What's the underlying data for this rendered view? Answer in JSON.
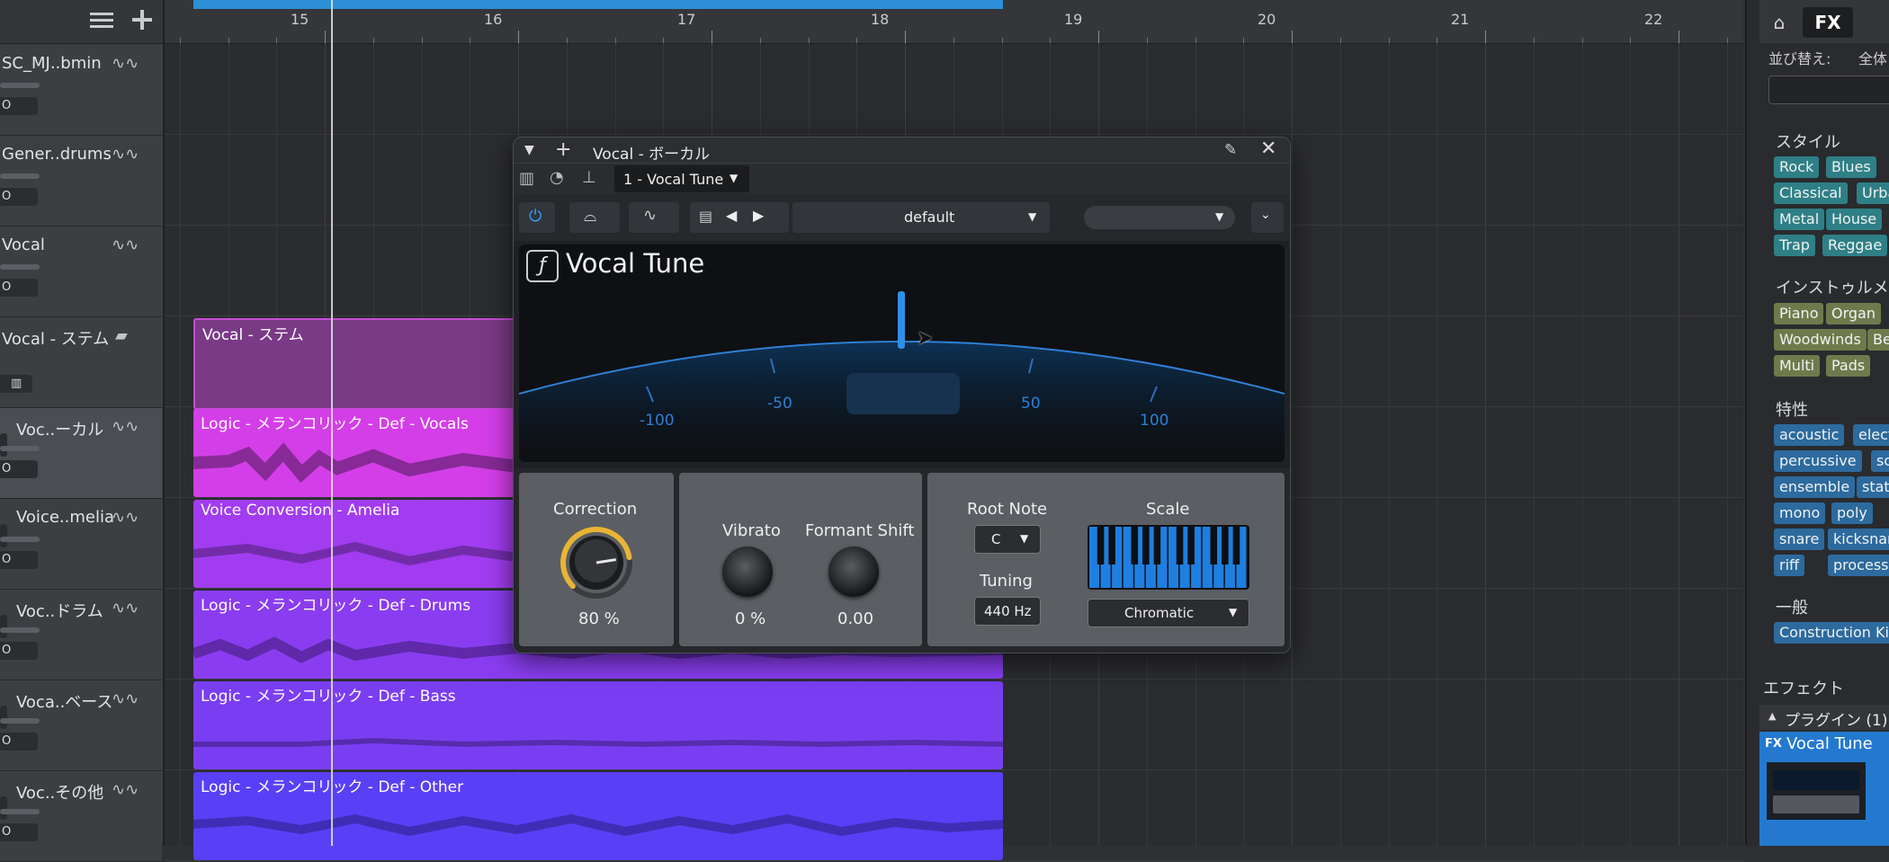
{
  "timeline": {
    "bars": [
      "15",
      "16",
      "17",
      "18",
      "19",
      "20",
      "21",
      "22"
    ]
  },
  "tracks": [
    {
      "name": "SC_MJ..bmin",
      "mon": "O"
    },
    {
      "name": "Gener..drums",
      "mon": "O"
    },
    {
      "name": "Vocal",
      "mon": "O"
    },
    {
      "name": "Vocal - ステム",
      "mon": ""
    },
    {
      "name": "Voc..ーカル",
      "mon": "O"
    },
    {
      "name": "Voice..melia",
      "mon": "O"
    },
    {
      "name": "Voc..ドラム",
      "mon": "O"
    },
    {
      "name": "Voca..ベース",
      "mon": "O"
    },
    {
      "name": "Voc..その他",
      "mon": "O"
    }
  ],
  "clips": [
    {
      "label": "Vocal - ステム"
    },
    {
      "label": "Logic - メランコリック - Def - Vocals"
    },
    {
      "label": "Voice Conversion - Amelia"
    },
    {
      "label": "Logic - メランコリック - Def - Drums"
    },
    {
      "label": "Logic - メランコリック - Def - Bass"
    },
    {
      "label": "Logic - メランコリック - Def - Other"
    }
  ],
  "plugin": {
    "window_title": "Vocal - ボーカル",
    "insert": "1 - Vocal Tune",
    "preset": "default",
    "name": "Vocal Tune",
    "meter_labels": [
      "-100",
      "-50",
      "50",
      "100"
    ],
    "correction_label": "Correction",
    "correction_value": "80 %",
    "correction_level": 0.8,
    "vibrato_label": "Vibrato",
    "vibrato_value": "0 %",
    "formant_label": "Formant Shift",
    "formant_value": "0.00",
    "root_note_label": "Root Note",
    "root_note_value": "C",
    "tuning_label": "Tuning",
    "tuning_value": "440 Hz",
    "scale_label": "Scale",
    "scale_value": "Chromatic"
  },
  "browser": {
    "tab_fx": "FX",
    "sort_label": "並び替え:",
    "sort_value": "全体",
    "sec_style": "スタイル",
    "style_tags": [
      "Rock",
      "Blues",
      "Classical",
      "Urban",
      "Metal",
      "House",
      "Trap",
      "Reggae"
    ],
    "sec_instrument": "インストゥルメ",
    "instrument_tags": [
      "Piano",
      "Organ",
      "Woodwinds",
      "Be",
      "Multi",
      "Pads"
    ],
    "sec_character": "特性",
    "character_tags": [
      "acoustic",
      "electric",
      "percussive",
      "sof",
      "ensemble",
      "static",
      "mono",
      "poly",
      "snare",
      "kicksnare",
      "riff",
      "processe"
    ],
    "sec_general": "一般",
    "general_tags": [
      "Construction Kit"
    ],
    "effects_label": "エフェクト",
    "plugin_group": "プラグイン (1)",
    "selected_plugin": "Vocal Tune",
    "selected_plugin_prefix": "FX"
  },
  "colors": {
    "accent_blue": "#2d8fd6",
    "clip_magenta": "#d43ee8",
    "clip_purple": "#8a3df0",
    "clip_violet": "#6b3ff5",
    "knob_ring": "#e8b436"
  }
}
